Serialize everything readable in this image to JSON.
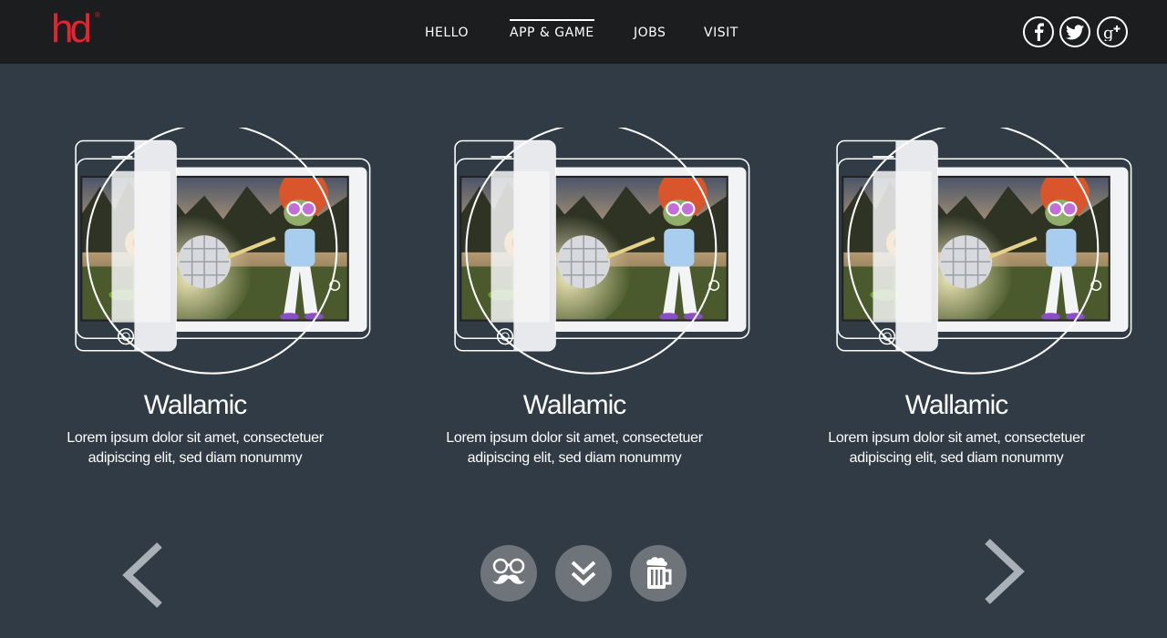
{
  "brand": {
    "logo_text": "hd",
    "registered": "®",
    "accent": "#e52431"
  },
  "nav": {
    "items": [
      {
        "label": "HELLO",
        "active": false
      },
      {
        "label": "APP & GAME",
        "active": true
      },
      {
        "label": "JOBS",
        "active": false
      },
      {
        "label": "VISIT",
        "active": false
      }
    ]
  },
  "social": [
    {
      "icon": "facebook-icon"
    },
    {
      "icon": "twitter-icon"
    },
    {
      "icon": "google-plus-icon"
    }
  ],
  "cards": [
    {
      "title": "Wallamic",
      "desc_line1": "Lorem ipsum dolor sit amet, consectetuer",
      "desc_line2": "adipiscing elit, sed diam nonummy"
    },
    {
      "title": "Wallamic",
      "desc_line1": "Lorem ipsum dolor sit amet, consectetuer",
      "desc_line2": "adipiscing elit, sed diam nonummy"
    },
    {
      "title": "Wallamic",
      "desc_line1": "Lorem ipsum dolor sit amet, consectetuer",
      "desc_line2": "adipiscing elit, sed diam nonummy"
    }
  ],
  "controls": {
    "prev_icon": "chevron-left-icon",
    "next_icon": "chevron-right-icon",
    "buttons": [
      {
        "icon": "glasses-mustache-icon"
      },
      {
        "icon": "double-chevron-down-icon"
      },
      {
        "icon": "beer-mug-icon"
      }
    ]
  },
  "colors": {
    "background": "#303b45",
    "topbar": "#1c1d1e",
    "button": "#6f747a"
  }
}
